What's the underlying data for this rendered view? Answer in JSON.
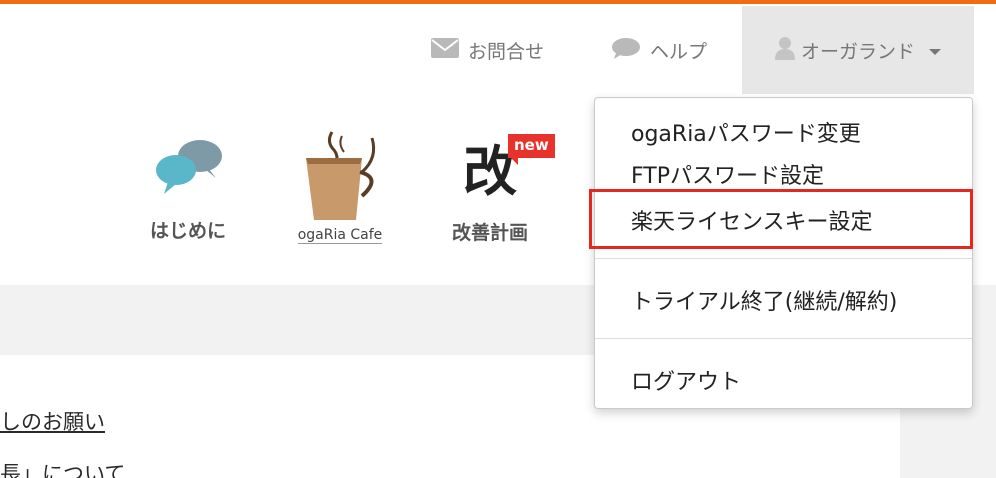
{
  "header": {
    "contact_label": "お問合せ",
    "help_label": "ヘルプ",
    "user_label": "オーガランド"
  },
  "tiles": {
    "hajime_label": "はじめに",
    "cafe_logo_text": "ogaRia Cafe",
    "kaizen_char": "改",
    "kaizen_badge": "new",
    "kaizen_label": "改善計画"
  },
  "dropdown": {
    "items": [
      {
        "label": "ogaRiaパスワード変更"
      },
      {
        "label": "FTPパスワード設定"
      },
      {
        "label": "楽天ライセンスキー設定"
      },
      {
        "label": "トライアル終了(継続/解約)"
      },
      {
        "label": "ログアウト"
      }
    ],
    "highlight_color": "#e5281e"
  },
  "content": {
    "link1": "しのお願い",
    "link2": "長」について"
  },
  "colors": {
    "accent_bar": "#f36b12",
    "new_badge": "#e8332d"
  },
  "icons": [
    "mail-icon",
    "speech-bubble-icon",
    "user-icon",
    "chevron-down-icon",
    "speech-bubbles-icon",
    "coffee-cup-icon"
  ]
}
